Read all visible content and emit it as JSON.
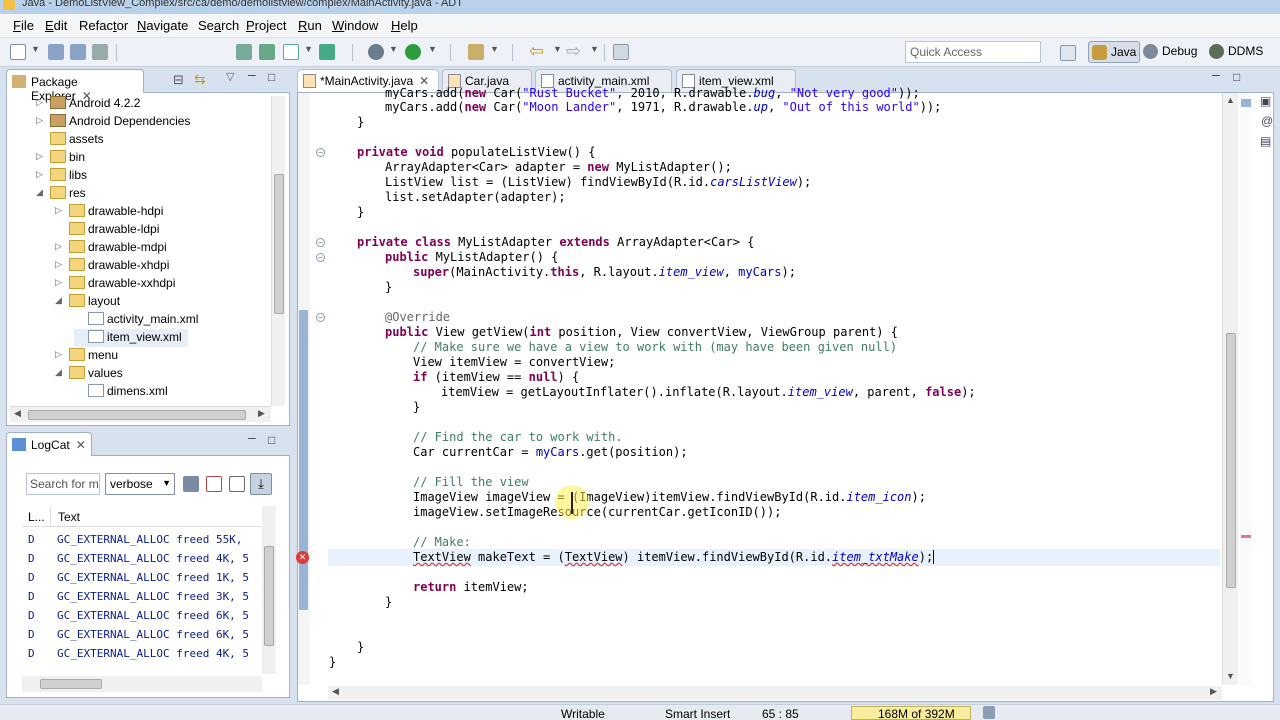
{
  "window": {
    "title": "Java - DemoListView_Complex/src/ca/demo/demolistview/complex/MainActivity.java - ADT"
  },
  "menu": {
    "items": [
      "File",
      "Edit",
      "Refactor",
      "Navigate",
      "Search",
      "Project",
      "Run",
      "Window",
      "Help"
    ],
    "underline": [
      "F",
      "E",
      "t",
      "N",
      "a",
      "P",
      "R",
      "W",
      "H"
    ]
  },
  "toolbar": {
    "quick_access_placeholder": "Quick Access",
    "perspectives": [
      "Java",
      "Debug",
      "DDMS"
    ]
  },
  "package_explorer": {
    "title": "Package Explorer",
    "items": [
      {
        "label": "Android 4.2.2",
        "type": "lib"
      },
      {
        "label": "Android Dependencies",
        "type": "lib"
      },
      {
        "label": "assets",
        "type": "folder"
      },
      {
        "label": "bin",
        "type": "folder"
      },
      {
        "label": "libs",
        "type": "folder"
      },
      {
        "label": "res",
        "type": "folder"
      },
      {
        "label": "drawable-hdpi",
        "type": "folder"
      },
      {
        "label": "drawable-ldpi",
        "type": "folder"
      },
      {
        "label": "drawable-mdpi",
        "type": "folder"
      },
      {
        "label": "drawable-xhdpi",
        "type": "folder"
      },
      {
        "label": "drawable-xxhdpi",
        "type": "folder"
      },
      {
        "label": "layout",
        "type": "folder"
      },
      {
        "label": "activity_main.xml",
        "type": "xml"
      },
      {
        "label": "item_view.xml",
        "type": "xml"
      },
      {
        "label": "menu",
        "type": "folder"
      },
      {
        "label": "values",
        "type": "folder"
      },
      {
        "label": "dimens.xml",
        "type": "xml"
      }
    ]
  },
  "logcat": {
    "title": "LogCat",
    "search_placeholder": "Search for m",
    "level": "verbose",
    "columns": [
      "L...",
      "Text"
    ],
    "rows": [
      {
        "level": "D",
        "text": "GC_EXTERNAL_ALLOC freed 55K,"
      },
      {
        "level": "D",
        "text": "GC_EXTERNAL_ALLOC freed 4K, 5"
      },
      {
        "level": "D",
        "text": "GC_EXTERNAL_ALLOC freed 1K, 5"
      },
      {
        "level": "D",
        "text": "GC_EXTERNAL_ALLOC freed 3K, 5"
      },
      {
        "level": "D",
        "text": "GC_EXTERNAL_ALLOC freed 6K, 5"
      },
      {
        "level": "D",
        "text": "GC_EXTERNAL_ALLOC freed 6K, 5"
      },
      {
        "level": "D",
        "text": "GC_EXTERNAL_ALLOC freed 4K, 5"
      }
    ]
  },
  "editor": {
    "tabs": [
      "*MainActivity.java",
      "Car.java",
      "activity_main.xml",
      "item_view.xml"
    ],
    "active_tab": 0,
    "lines": {
      "l01": "myCars.add(new Car(\"Rust Bucket\", 2010, R.drawable.bug, \"Not very good\"));",
      "l02": "myCars.add(new Car(\"Moon Lander\", 1971, R.drawable.up, \"Out of this world\"));",
      "l03": "}",
      "l04": "private void populateListView() {",
      "l05": "ArrayAdapter<Car> adapter = new MyListAdapter();",
      "l06": "ListView list = (ListView) findViewById(R.id.carsListView);",
      "l07": "list.setAdapter(adapter);",
      "l08": "}",
      "l09": "private class MyListAdapter extends ArrayAdapter<Car> {",
      "l10": "public MyListAdapter() {",
      "l11": "super(MainActivity.this, R.layout.item_view, myCars);",
      "l12": "}",
      "l13": "@Override",
      "l14": "public View getView(int position, View convertView, ViewGroup parent) {",
      "l15": "// Make sure we have a view to work with (may have been given null)",
      "l16": "View itemView = convertView;",
      "l17": "if (itemView == null) {",
      "l18": "itemView = getLayoutInflater().inflate(R.layout.item_view, parent, false);",
      "l19": "}",
      "l20": "// Find the car to work with.",
      "l21": "Car currentCar = myCars.get(position);",
      "l22": "// Fill the view",
      "l23": "ImageView imageView = (ImageView)itemView.findViewById(R.id.item_icon);",
      "l24": "imageView.setImageResource(currentCar.getIconID());",
      "l25": "// Make:",
      "l26": "TextView makeText = (TextView) itemView.findViewById(R.id.item_txtMake);",
      "l27": "return itemView;",
      "l28": "}",
      "l29": "}",
      "l30": "}"
    }
  },
  "status": {
    "writable": "Writable",
    "insert_mode": "Smart Insert",
    "position": "65 : 85",
    "memory": "168M of 392M"
  }
}
